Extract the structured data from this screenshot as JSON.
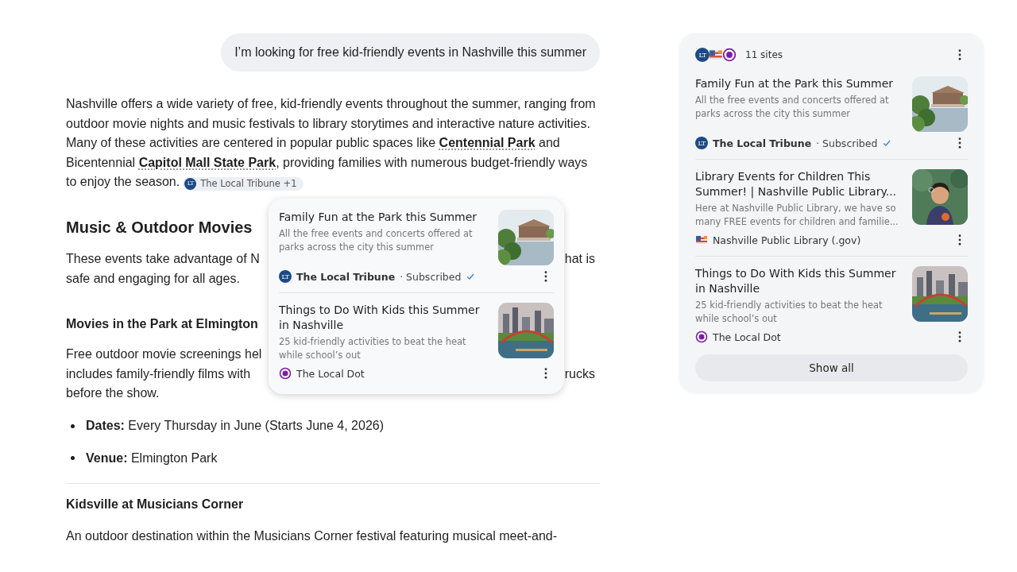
{
  "user_message": "I’m looking for free kid-friendly events in Nashville this summer",
  "answer": [
    {
      "kind": "paragraph",
      "text": "Nashville offers a wide variety of free, kid-friendly events throughout the summer, ranging from outdoor movie nights and music festivals to library storytimes and interactive nature activities. Many of these activities are centered in popular public spaces like **Centennial Park** and Bicentennial **Capitol Mall State Park**, providing families with numerous budget-friendly ways to enjoy the season.",
      "citation": {
        "badge": "LT",
        "label": "The Local Tribune +1"
      }
    },
    {
      "kind": "heading",
      "text": "Music & Outdoor Movies"
    },
    {
      "kind": "covered",
      "lines": [
        {
          "left": "These events take advantage of N",
          "right": "hat is"
        },
        {
          "left": "safe and engaging for all ages."
        }
      ]
    },
    {
      "kind": "subheading",
      "text": "Movies in the Park at Elmington",
      "divider_before": false
    },
    {
      "kind": "covered",
      "lines": [
        {
          "left": "Free outdoor movie screenings hel"
        },
        {
          "left": "includes family-friendly films with",
          "right": "rucks"
        },
        {
          "left": "before the show."
        }
      ]
    },
    {
      "kind": "bullet",
      "text": "**Dates:** Every Thursday in June (Starts June 4, 2026)"
    },
    {
      "kind": "bullet",
      "text": "**Venue:** Elmington Park"
    },
    {
      "kind": "subheading",
      "text": "Kidsville at Musicians Corner",
      "divider_before": true
    },
    {
      "kind": "paragraph",
      "text": "An outdoor destination within the Musicians Corner festival featuring musical meet-and-"
    }
  ],
  "popup": {
    "cards": [
      {
        "title": "Family Fun at the Park this Summer",
        "snippet": "All the free events and concerts offered at parks across the city this summer",
        "source": {
          "kind": "lt",
          "badge": "LT",
          "name": "The Local Tribune",
          "status": "· Subscribed",
          "verified": true
        }
      },
      {
        "title": "Things to Do With Kids this Summer in Nashville",
        "snippet": "25 kid-friendly activities to beat the heat while school’s out",
        "source": {
          "kind": "dot",
          "name": "The Local Dot"
        }
      }
    ]
  },
  "sources_panel": {
    "logos": [
      {
        "kind": "lt",
        "badge": "LT"
      },
      {
        "kind": "flag"
      },
      {
        "kind": "dot"
      }
    ],
    "count": "11 sites",
    "cards": [
      {
        "title": "Family Fun at the Park this Summer",
        "snippet": "All the free events and concerts offered at parks across the city this summer",
        "source": {
          "kind": "lt",
          "badge": "LT",
          "name": "The Local Tribune",
          "status": "· Subscribed",
          "verified": true
        }
      },
      {
        "title": "Library Events for Children This Summer! | Nashville Public Library...",
        "snippet": "Here at Nashville Public Library, we have so many FREE events for children and familie...",
        "source": {
          "kind": "flag",
          "name": "Nashville Public Library (.gov)"
        }
      },
      {
        "title": "Things to Do With Kids this Summer in Nashville",
        "snippet": "25 kid-friendly activities to beat the heat while school’s out",
        "source": {
          "kind": "dot",
          "name": "The Local Dot"
        }
      }
    ],
    "button": "Show all"
  }
}
